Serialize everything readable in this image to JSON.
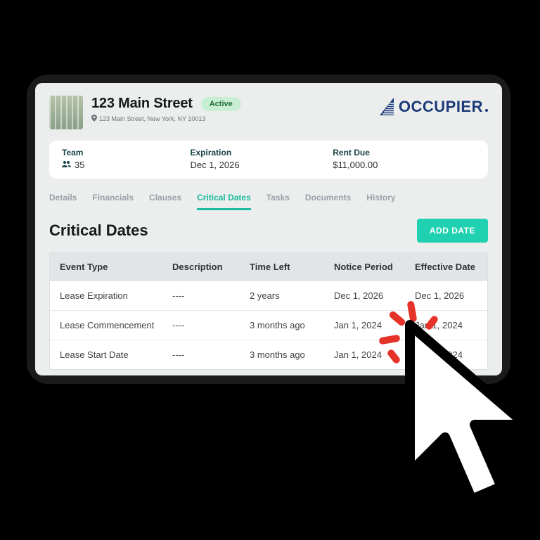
{
  "brand": {
    "name": "OCCUPIER"
  },
  "property": {
    "title": "123 Main Street",
    "status": "Active",
    "address": "123 Main Street, New York, NY 10013"
  },
  "summary": {
    "team_label": "Team",
    "team_count": "35",
    "expiration_label": "Expiration",
    "expiration_value": "Dec 1, 2026",
    "rent_label": "Rent Due",
    "rent_value": "$11,000.00"
  },
  "tabs": {
    "details": "Details",
    "financials": "Financials",
    "clauses": "Clauses",
    "critical_dates": "Critical Dates",
    "tasks": "Tasks",
    "documents": "Documents",
    "history": "History"
  },
  "section": {
    "title": "Critical Dates",
    "add_button": "ADD DATE"
  },
  "table": {
    "headers": {
      "event_type": "Event Type",
      "description": "Description",
      "time_left": "Time Left",
      "notice_period": "Notice Period",
      "effective_date": "Effective Date"
    },
    "rows": [
      {
        "event_type": "Lease Expiration",
        "description": "----",
        "time_left": "2 years",
        "notice_period": "Dec 1, 2026",
        "effective_date": "Dec 1, 2026"
      },
      {
        "event_type": "Lease Commencement",
        "description": "----",
        "time_left": "3 months ago",
        "notice_period": "Jan 1, 2024",
        "effective_date": "Jan 1, 2024"
      },
      {
        "event_type": "Lease Start Date",
        "description": "----",
        "time_left": "3 months ago",
        "notice_period": "Jan 1, 2024",
        "effective_date": "Jan 1, 2024"
      }
    ]
  }
}
